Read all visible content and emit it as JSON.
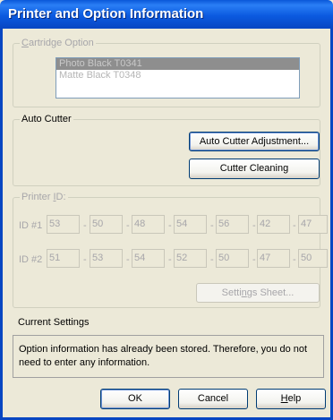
{
  "window": {
    "title": "Printer and Option Information"
  },
  "cartridge": {
    "legend": "Cartridge Option",
    "legend_accel": "C",
    "legend_rest": "artridge Option",
    "items": [
      "Photo Black T0341",
      "Matte Black T0348"
    ],
    "selected_index": 0
  },
  "auto_cutter": {
    "legend": "Auto Cutter",
    "adjust_label": "Auto Cutter Adjustment...",
    "cleaning_label": "Cutter Cleaning"
  },
  "printer_id": {
    "legend": "Printer ID:",
    "legend_pre": "Printer ",
    "legend_accel": "I",
    "legend_post": "D:",
    "id1_label": "ID #1",
    "id2_label": "ID #2",
    "id1": [
      "53",
      "50",
      "48",
      "54",
      "56",
      "42",
      "47"
    ],
    "id2": [
      "51",
      "53",
      "54",
      "52",
      "50",
      "47",
      "50"
    ],
    "separator": "-",
    "settings_sheet_label": "Settings Sheet...",
    "settings_pre": "Setti",
    "settings_accel": "n",
    "settings_post": "gs Sheet..."
  },
  "current_settings": {
    "title": "Current Settings",
    "message": "Option information has already been stored. Therefore, you do not need to enter any information."
  },
  "buttons": {
    "ok": "OK",
    "cancel": "Cancel",
    "help_accel": "H",
    "help_rest": "elp"
  },
  "colors": {
    "titlebar": "#0a58d8",
    "dialog_bg": "#ece9d8",
    "disabled_text": "#a7a6aa"
  }
}
